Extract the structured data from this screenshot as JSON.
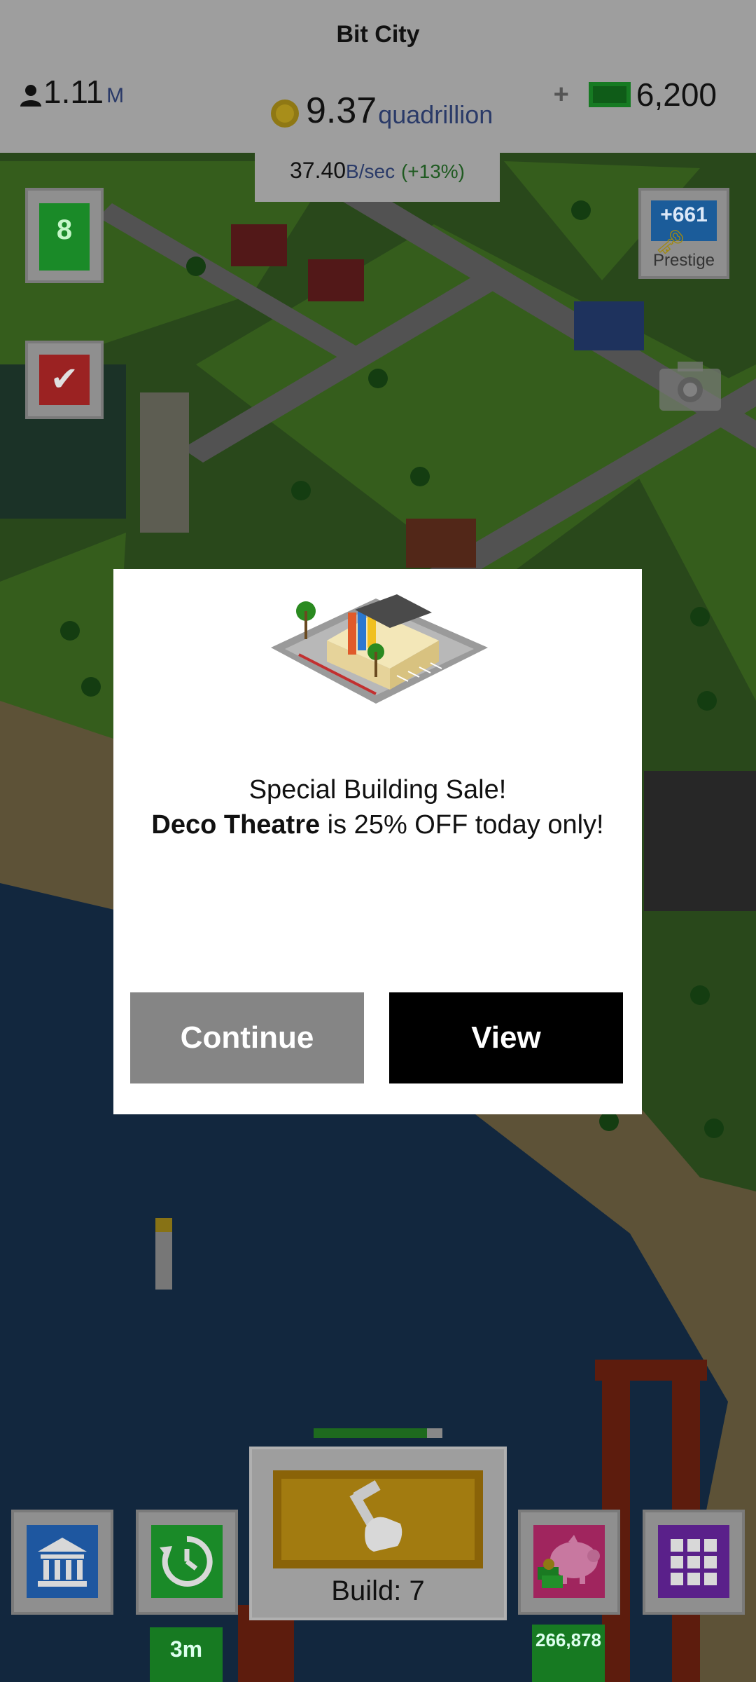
{
  "hud": {
    "city_name": "Bit City",
    "population": {
      "value": "1.11",
      "unit": "M"
    },
    "coins": {
      "value": "9.37",
      "unit": "quadrillion"
    },
    "cash": {
      "plus": "+",
      "value": "6,200"
    },
    "income_rate": {
      "value": "37.40",
      "unit": "B/sec",
      "bonus": "(+13%)"
    }
  },
  "side": {
    "level": "8",
    "prestige": {
      "value": "+661",
      "label": "Prestige"
    }
  },
  "modal": {
    "line1": "Special Building Sale!",
    "building_name": "Deco Theatre",
    "line2_rest": " is 25% OFF today only!",
    "continue_label": "Continue",
    "view_label": "View"
  },
  "toolbar": {
    "history_timer": "3m",
    "savings_amount": "266,878",
    "build_label": "Build: 7",
    "build_progress": 0.88
  },
  "colors": {
    "hud_bg": "#9e9e9e",
    "modal_bg": "#ffffff",
    "view_button": "#000000",
    "continue_button": "#858585",
    "level_green": "#1a8a28"
  },
  "icons": [
    "person-icon",
    "coin-icon",
    "cash-icon",
    "check-icon",
    "key-icon",
    "camera-icon",
    "bank-icon",
    "clock-icon",
    "hammer-icon",
    "piggy-bank-icon",
    "grid-icon"
  ]
}
